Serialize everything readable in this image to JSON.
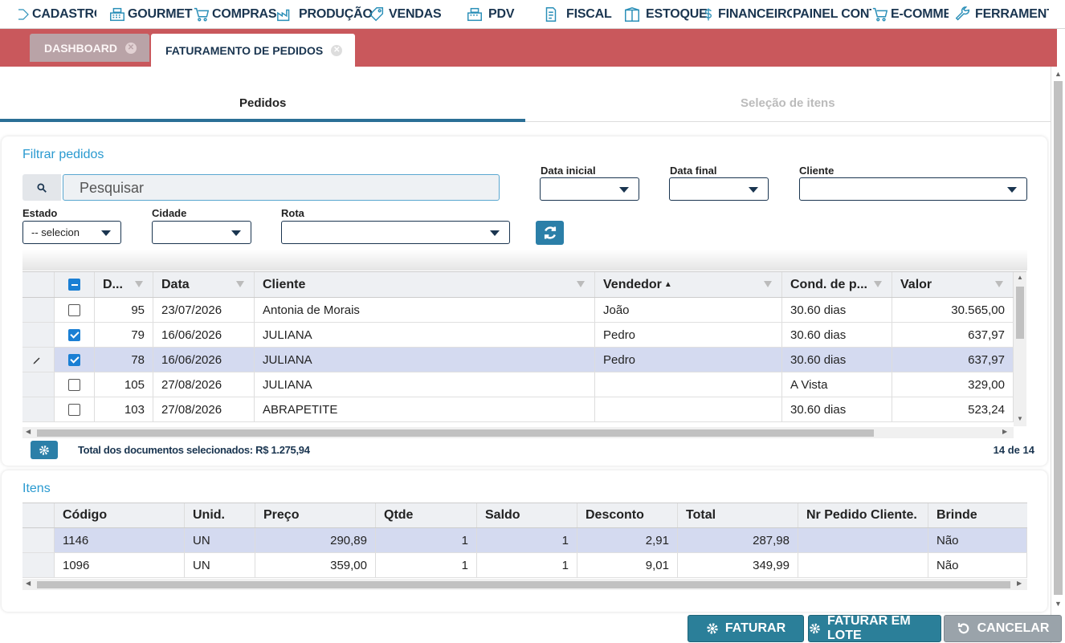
{
  "nav": [
    {
      "label": "CADASTROS",
      "icon": "box-icon"
    },
    {
      "label": "GOURMET",
      "icon": "register-icon"
    },
    {
      "label": "COMPRAS",
      "icon": "cart-icon"
    },
    {
      "label": "PRODUÇÃO",
      "icon": "factory-icon"
    },
    {
      "label": "VENDAS",
      "icon": "tag-icon"
    },
    {
      "label": "PDV",
      "icon": "register-icon"
    },
    {
      "label": "FISCAL",
      "icon": "document-icon"
    },
    {
      "label": "ESTOQUE",
      "icon": "package-icon"
    },
    {
      "label": "FINANCEIRO",
      "icon": "dollar-icon"
    },
    {
      "label": "PAINEL CONTÁBIL",
      "icon": "chart-icon"
    },
    {
      "label": "E-COMMERCE",
      "icon": "cart-icon"
    },
    {
      "label": "FERRAMENTAS",
      "icon": "wrench-icon"
    }
  ],
  "tabs": {
    "dashboard": "DASHBOARD",
    "faturamento": "FATURAMENTO DE PEDIDOS"
  },
  "steps": {
    "pedidos": "Pedidos",
    "selecao": "Seleção de itens"
  },
  "filter": {
    "title": "Filtrar pedidos",
    "search_placeholder": "Pesquisar",
    "data_inicial": "Data inicial",
    "data_final": "Data final",
    "cliente": "Cliente",
    "estado": "Estado",
    "estado_value": "-- selecion",
    "cidade": "Cidade",
    "rota": "Rota"
  },
  "orders": {
    "headers": [
      "D...",
      "Data",
      "Cliente",
      "Vendedor",
      "Cond. de p...",
      "Valor"
    ],
    "rows": [
      {
        "checked": false,
        "n": "95",
        "data": "23/07/2026",
        "cliente": "Antonia de Morais",
        "vendedor": "João",
        "cond": "30.60 dias",
        "valor": "30.565,00"
      },
      {
        "checked": true,
        "n": "79",
        "data": "16/06/2026",
        "cliente": "JULIANA",
        "vendedor": "Pedro",
        "cond": "30.60 dias",
        "valor": "637,97"
      },
      {
        "checked": true,
        "n": "78",
        "data": "16/06/2026",
        "cliente": "JULIANA",
        "vendedor": "Pedro",
        "cond": "30.60 dias",
        "valor": "637,97"
      },
      {
        "checked": false,
        "n": "105",
        "data": "27/08/2026",
        "cliente": "JULIANA",
        "vendedor": "",
        "cond": "A Vista",
        "valor": "329,00"
      },
      {
        "checked": false,
        "n": "103",
        "data": "27/08/2026",
        "cliente": "ABRAPETITE",
        "vendedor": "",
        "cond": "30.60 dias",
        "valor": "523,24"
      }
    ],
    "total_label": "Total dos documentos selecionados: R$ 1.275,94",
    "count": "14 de 14"
  },
  "items": {
    "title": "Itens",
    "headers": [
      "Código",
      "Unid.",
      "Preço",
      "Qtde",
      "Saldo",
      "Desconto",
      "Total",
      "Nr Pedido Cliente.",
      "Brinde"
    ],
    "rows": [
      {
        "codigo": "1146",
        "unid": "UN",
        "preco": "290,89",
        "qtde": "1",
        "saldo": "1",
        "desconto": "2,91",
        "total": "287,98",
        "nr": "",
        "brinde": "Não"
      },
      {
        "codigo": "1096",
        "unid": "UN",
        "preco": "359,00",
        "qtde": "1",
        "saldo": "1",
        "desconto": "9,01",
        "total": "349,99",
        "nr": "",
        "brinde": "Não"
      }
    ]
  },
  "buttons": {
    "faturar": "FATURAR",
    "lote": "FATURAR EM LOTE",
    "cancelar": "CANCELAR"
  },
  "colors": {
    "accent": "#2b7f99",
    "tabbar": "#c9585c",
    "title_blue": "#2a9ad0",
    "selected_row": "#d4daf0"
  }
}
